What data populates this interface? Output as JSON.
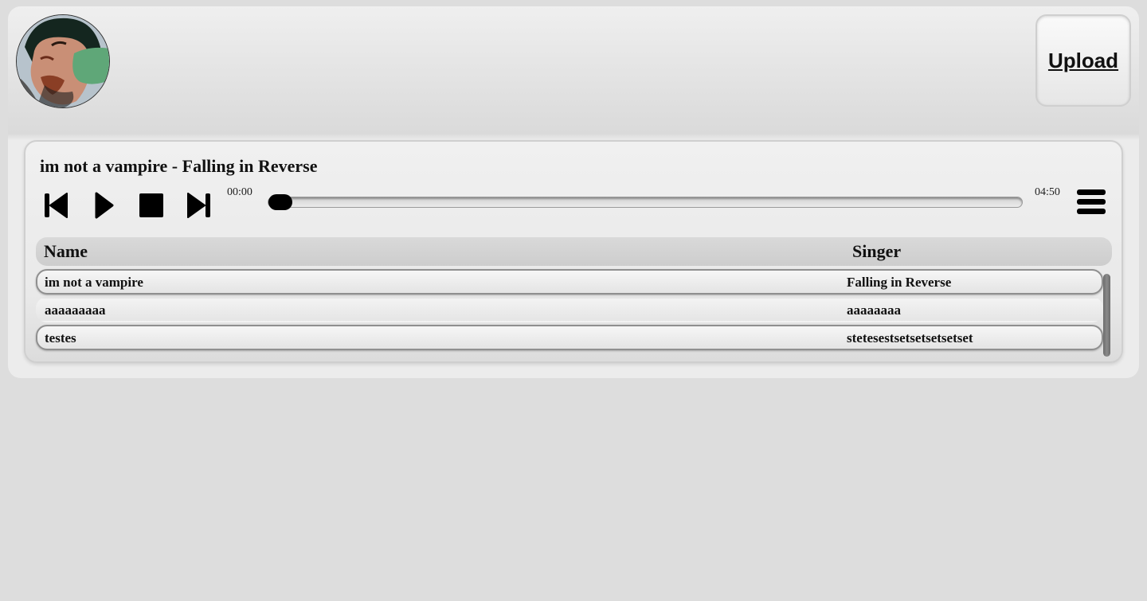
{
  "header": {
    "avatar_alt": "user avatar",
    "upload_label": "Upload"
  },
  "player": {
    "now_playing": "im not a vampire - Falling in Reverse",
    "current_time": "00:00",
    "duration": "04:50",
    "progress": 0.0,
    "controls": {
      "previous_icon": "skip-previous-icon",
      "play_icon": "play-icon",
      "stop_icon": "stop-icon",
      "next_icon": "skip-next-icon",
      "menu_icon": "hamburger-menu-icon"
    }
  },
  "playlist": {
    "columns": [
      "Name",
      "Singer"
    ],
    "rows": [
      {
        "name": "im not a vampire",
        "singer": "Falling in Reverse"
      },
      {
        "name": "aaaaaaaaa",
        "singer": "aaaaaaaa"
      },
      {
        "name": "testes",
        "singer": "stetesestsetsetsetsetset"
      }
    ]
  },
  "colors": {
    "background": "#dddddd",
    "panel": "#ececec",
    "text": "#111111",
    "controls": "#000000"
  }
}
